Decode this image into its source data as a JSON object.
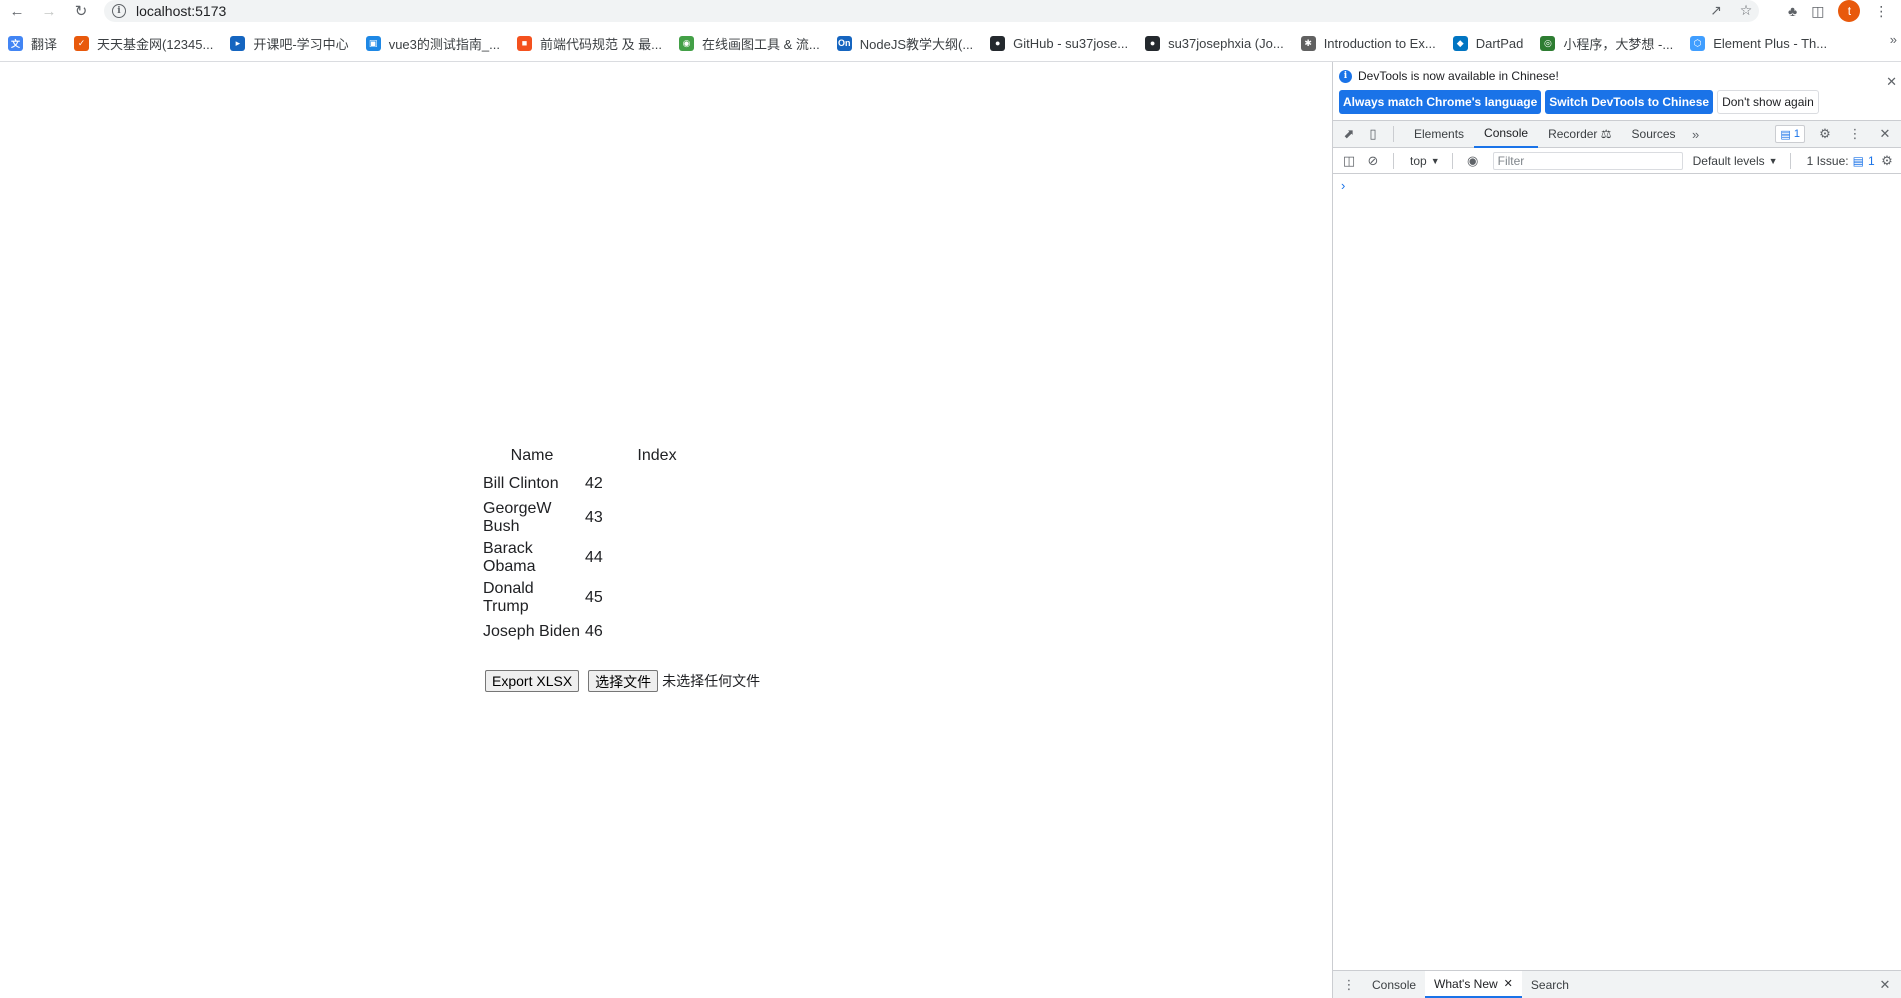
{
  "browser": {
    "url": "localhost:5173",
    "back_icon": "arrow-left-icon",
    "forward_icon": "arrow-right-icon",
    "reload_icon": "reload-icon",
    "avatar_letter": "t"
  },
  "bookmarks": [
    {
      "label": "翻译",
      "icon": "translate-icon",
      "color": "#4285f4"
    },
    {
      "label": "天天基金网(12345...",
      "icon": "fund-icon",
      "color": "#e8590c"
    },
    {
      "label": "开课吧-学习中心",
      "icon": "kaikeba-icon",
      "color": "#1565c0"
    },
    {
      "label": "vue3的测试指南_...",
      "icon": "calendar-icon",
      "color": "#1e88e5"
    },
    {
      "label": "前端代码规范 及 最...",
      "icon": "doc-icon",
      "color": "#f4511e"
    },
    {
      "label": "在线画图工具 & 流...",
      "icon": "draw-icon",
      "color": "#43a047"
    },
    {
      "label": "NodeJS教学大纲(...",
      "icon": "on-icon",
      "color": "#1565c0"
    },
    {
      "label": "GitHub - su37jose...",
      "icon": "github-icon",
      "color": "#24292e"
    },
    {
      "label": "su37josephxia (Jo...",
      "icon": "github-icon",
      "color": "#24292e"
    },
    {
      "label": "Introduction to Ex...",
      "icon": "express-icon",
      "color": "#616161"
    },
    {
      "label": "DartPad",
      "icon": "dart-icon",
      "color": "#0175c2"
    },
    {
      "label": "小程序，大梦想 -...",
      "icon": "wechat-icon",
      "color": "#2e7d32"
    },
    {
      "label": "Element Plus - Th...",
      "icon": "element-icon",
      "color": "#409eff"
    }
  ],
  "table": {
    "headers": [
      "Name",
      "Index"
    ],
    "rows": [
      {
        "name": "Bill Clinton",
        "index": "42"
      },
      {
        "name": "GeorgeW Bush",
        "index": "43"
      },
      {
        "name": "Barack Obama",
        "index": "44"
      },
      {
        "name": "Donald Trump",
        "index": "45"
      },
      {
        "name": "Joseph Biden",
        "index": "46"
      }
    ]
  },
  "controls": {
    "export_label": "Export XLSX",
    "choose_file_label": "选择文件",
    "file_status": "未选择任何文件"
  },
  "devtools": {
    "banner_message": "DevTools is now available in Chinese!",
    "match_language_label": "Always match Chrome's language",
    "switch_chinese_label": "Switch DevTools to Chinese",
    "dont_show_label": "Don't show again",
    "tabs": [
      "Elements",
      "Console",
      "Recorder",
      "Sources"
    ],
    "active_tab": "Console",
    "message_count": "1",
    "context": "top",
    "filter_placeholder": "Filter",
    "levels": "Default levels",
    "issues": "1 Issue:",
    "issues_count": "1",
    "prompt": "›",
    "drawer_tabs": [
      "Console",
      "What's New",
      "Search"
    ],
    "drawer_active": "What's New"
  }
}
